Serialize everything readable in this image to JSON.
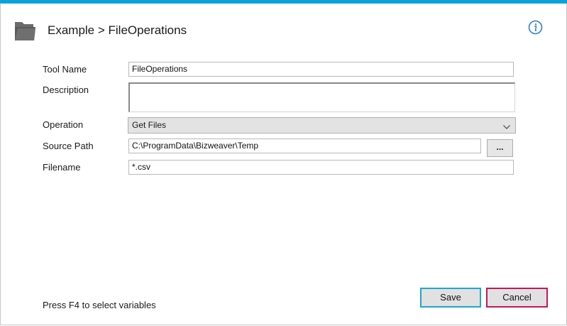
{
  "header": {
    "title": "Example > FileOperations",
    "folder_icon": "folder-icon",
    "info_icon": "info-icon"
  },
  "form": {
    "tool_name_label": "Tool Name",
    "tool_name_value": "FileOperations",
    "description_label": "Description",
    "description_value": "",
    "operation_label": "Operation",
    "operation_value": "Get Files",
    "source_path_label": "Source Path",
    "source_path_value": "C:\\ProgramData\\Bizweaver\\Temp",
    "browse_label": "...",
    "filename_label": "Filename",
    "filename_value": "*.csv"
  },
  "footer": {
    "hint": "Press F4 to select variables",
    "save_label": "Save",
    "cancel_label": "Cancel"
  },
  "colors": {
    "accent": "#0aa3d8",
    "save_border": "#1fa6cf",
    "cancel_border": "#c2185b",
    "info_icon": "#2b7fd4"
  }
}
